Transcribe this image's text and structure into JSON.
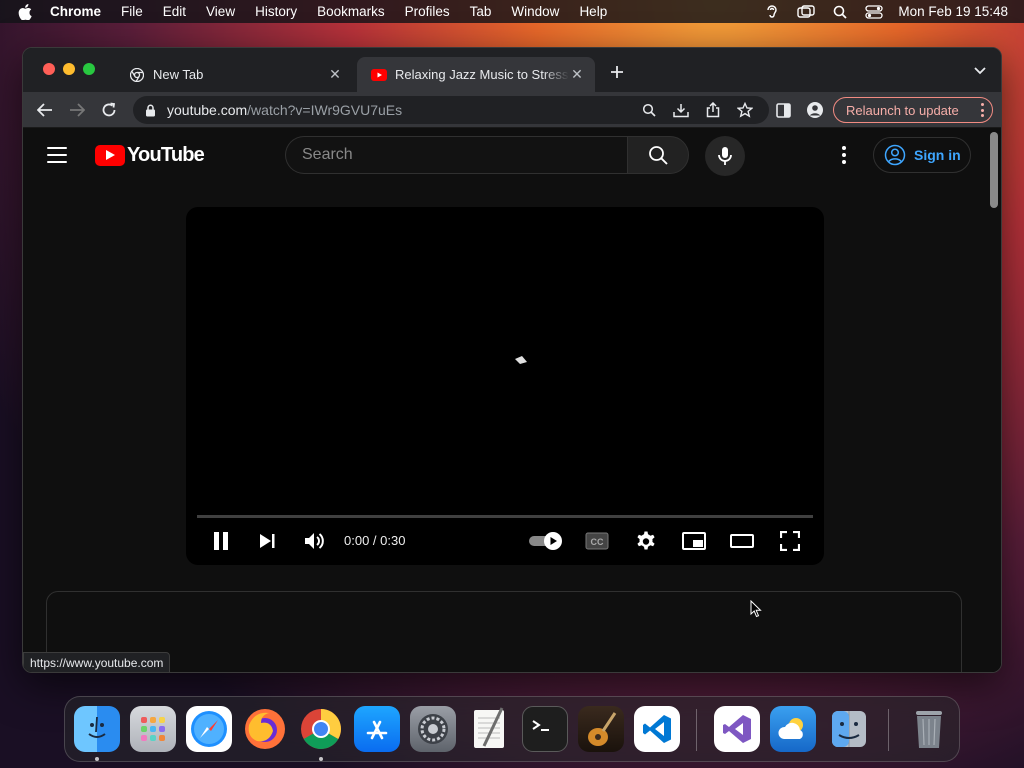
{
  "menubar": {
    "app_name": "Chrome",
    "items": [
      "File",
      "Edit",
      "View",
      "History",
      "Bookmarks",
      "Profiles",
      "Tab",
      "Window",
      "Help"
    ],
    "clock": "Mon Feb 19  15:48"
  },
  "browser": {
    "tabs": [
      {
        "title": "New Tab",
        "active": false
      },
      {
        "title": "Relaxing Jazz Music to Stress Relief",
        "active": true
      }
    ],
    "url_host": "youtube.com",
    "url_path": "/watch?v=IWr9GVU7uEs",
    "relaunch_label": "Relaunch to update",
    "status_url": "https://www.youtube.com",
    "relaunch_color": "#f28b82"
  },
  "youtube": {
    "logo_text": "YouTube",
    "search_placeholder": "Search",
    "signin_label": "Sign in",
    "accent_color": "#3ea6ff",
    "brand_color": "#ff0000"
  },
  "player": {
    "time_display": "0:00 / 0:30",
    "progress": 0
  },
  "dock": {
    "apps": [
      "finder",
      "launchpad",
      "safari",
      "firefox",
      "chrome",
      "app-store",
      "system-preferences",
      "textedit",
      "terminal",
      "garageband",
      "vscode",
      "visual-studio",
      "weather",
      "migration-assistant",
      "trash"
    ]
  }
}
